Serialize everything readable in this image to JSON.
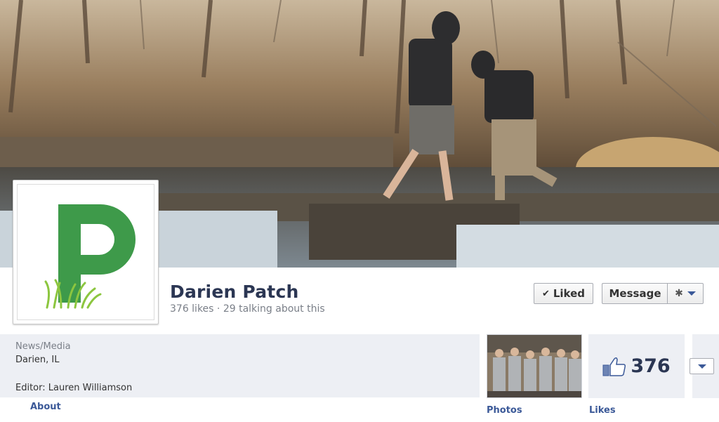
{
  "page": {
    "name": "Darien Patch",
    "stats": "376 likes · 29 talking about this",
    "logo_letter": "P",
    "logo_color": "#3e9a4a"
  },
  "actions": {
    "liked_label": "Liked",
    "message_label": "Message",
    "settings_icon": "gear-icon"
  },
  "info": {
    "category": "News/Media",
    "location": "Darien, IL",
    "editor": "Editor: Lauren Williamson",
    "about_link": "About"
  },
  "tiles": {
    "photos_label": "Photos",
    "likes_label": "Likes",
    "likes_count": "376"
  },
  "colors": {
    "link": "#3b5998",
    "title": "#2b3653",
    "panel": "#edeff4"
  }
}
